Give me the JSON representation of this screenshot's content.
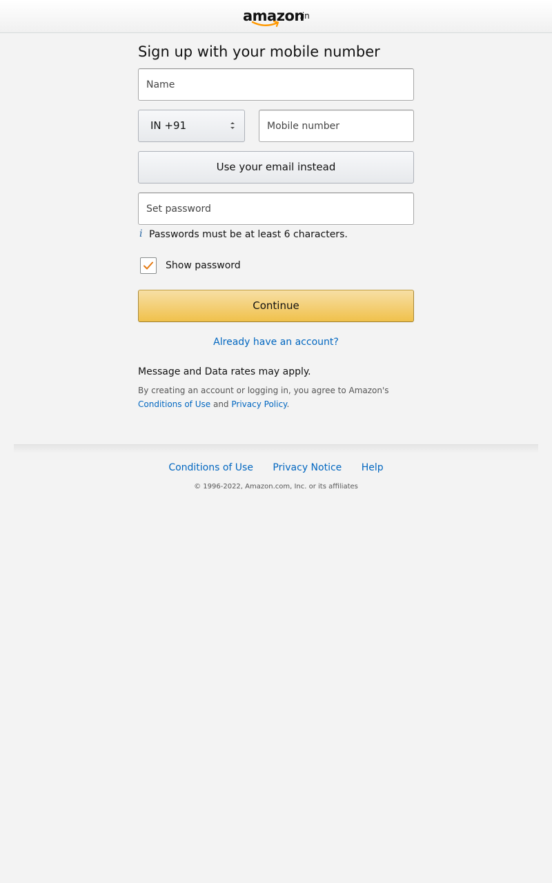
{
  "header": {
    "logo_text": "amazon",
    "logo_suffix": ".in"
  },
  "form": {
    "title": "Sign up with your mobile number",
    "name_placeholder": "Name",
    "country_code": "IN +91",
    "mobile_placeholder": "Mobile number",
    "use_email_label": "Use your email instead",
    "password_placeholder": "Set password",
    "password_hint": "Passwords must be at least 6 characters.",
    "show_password_label": "Show password",
    "show_password_checked": true,
    "continue_label": "Continue",
    "signin_link": "Already have an account?"
  },
  "legal": {
    "rates_notice": "Message and Data rates may apply.",
    "agreement_prefix": "By creating an account or logging in, you agree to Amazon's",
    "conditions_link": "Conditions of Use",
    "and_text": "and",
    "privacy_link": "Privacy Policy",
    "period": "."
  },
  "footer": {
    "links": [
      "Conditions of Use",
      "Privacy Notice",
      "Help"
    ],
    "copyright": "© 1996-2022, Amazon.com, Inc. or its affiliates"
  },
  "colors": {
    "link": "#0066c0",
    "primary_button": "#f0c14b",
    "logo_smile": "#ff9900",
    "info_icon": "#2162a1",
    "check": "#e47911"
  }
}
